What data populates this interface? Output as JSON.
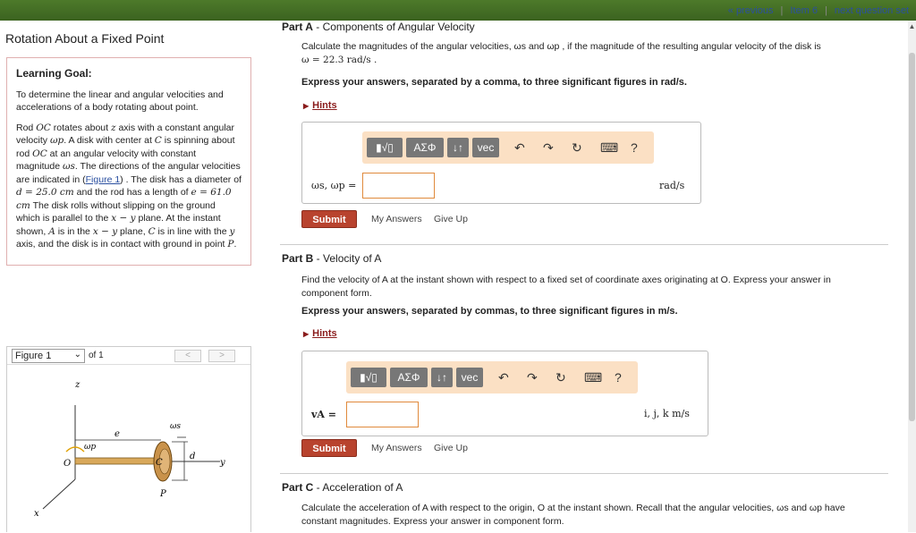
{
  "nav": {
    "previous": "« previous",
    "item": "Item 6",
    "next": "next question set"
  },
  "left": {
    "title": "Rotation About a Fixed Point",
    "goal_heading": "Learning Goal:",
    "goal_text": "To determine the linear and angular velocities and accelerations of a body rotating about point.",
    "desc_1": "Rod ",
    "desc_OC": "OC",
    "desc_2": " rotates about ",
    "desc_z": "z",
    "desc_3": " axis with a constant angular velocity ",
    "desc_wp": "ωp",
    "desc_4": ". A disk with center at ",
    "desc_C": "C",
    "desc_5": " is spinning about rod ",
    "desc_6": " at an angular velocity with constant magnitude ",
    "desc_ws": "ωs",
    "desc_7": ". The directions of the angular velocities are indicated in (",
    "figure_link": "Figure 1",
    "desc_8": ") . The disk has a diameter of ",
    "d_eq": "d = 25.0 cm",
    "desc_9": " and the rod has a length of ",
    "e_eq": "e = 61.0 cm",
    "desc_10": " The disk rolls without slipping on the ground which is parallel to the ",
    "xy1": "x − y",
    "desc_11": " plane. At the instant shown, ",
    "A": "A",
    "desc_12": " is in the ",
    "xy2": "x − y",
    "desc_13": " plane, ",
    "desc_14": " is in line with the ",
    "y": "y",
    "desc_15": " axis, and the disk is in contact with ground in point ",
    "P": "P",
    "desc_16": ".",
    "figure_select": "Figure 1",
    "figure_of": "of 1",
    "prev_fig": "<",
    "next_fig": ">"
  },
  "figure": {
    "z": "z",
    "e": "e",
    "ws": "ωs",
    "wp": "ωp",
    "d": "d",
    "O": "O",
    "C": "C",
    "y": "y",
    "P": "P",
    "x": "x"
  },
  "partA": {
    "label": "Part A",
    "title": " - Components of Angular Velocity",
    "q1": "Calculate the magnitudes of the angular velocities, ωs and ωp , if the magnitude of the resulting angular velocity of the disk is",
    "q2": "ω = 22.3 rad/s .",
    "instr": "Express your answers, separated by a comma, to three significant figures in rad/s.",
    "hints": "Hints",
    "answer_label": "ωs, ωp =",
    "unit": "rad/s",
    "submit": "Submit",
    "my_answers": "My Answers",
    "give_up": "Give Up"
  },
  "partB": {
    "label": "Part B",
    "title": " - Velocity of A",
    "q1": "Find the velocity of A at the instant shown with respect to a fixed set of coordinate axes originating at O. Express your answer in",
    "q2": "component form.",
    "instr": "Express your answers, separated by commas, to three significant figures in m/s.",
    "hints": "Hints",
    "answer_label": "vA =",
    "unit": "i, j, k m/s",
    "submit": "Submit",
    "my_answers": "My Answers",
    "give_up": "Give Up"
  },
  "partC": {
    "label": "Part C",
    "title": " - Acceleration of A",
    "q1": "Calculate the acceleration of A with respect to the origin, O at the instant shown. Recall that the angular velocities, ωs and ωp have",
    "q2": "constant magnitudes. Express your answer in component form."
  },
  "toolbar": {
    "templates": "▮√▯",
    "greek": "ΑΣΦ",
    "arrows": "↓↑",
    "vec": "vec",
    "undo": "↶",
    "redo": "↷",
    "reset": "↻",
    "keyboard": "⌨",
    "help": "?"
  }
}
